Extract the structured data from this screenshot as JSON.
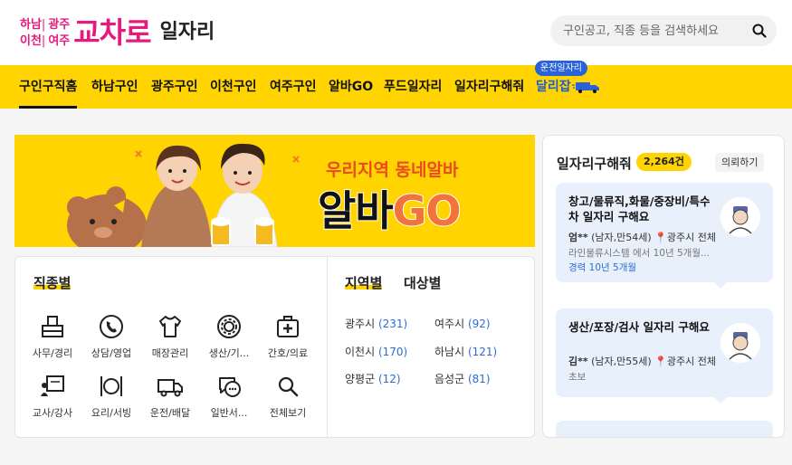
{
  "logo": {
    "regions": [
      "하남",
      "광주",
      "이천",
      "여주"
    ],
    "separator": "|",
    "main": "교차로",
    "sub": "일자리"
  },
  "search": {
    "placeholder": "구인공고, 직종 등을 검색하세요"
  },
  "nav": {
    "items": [
      "구인구직홈",
      "하남구인",
      "광주구인",
      "이천구인",
      "여주구인",
      "알바GO",
      "푸드일자리",
      "일자리구해줘",
      "달리잡"
    ],
    "active_index": 0,
    "badge": "운전일자리"
  },
  "banner": {
    "headline": "우리지역 동네알바",
    "brand_part1": "알바",
    "brand_part2": "GO"
  },
  "job_categories": {
    "title": "직종별",
    "items": [
      {
        "label": "사무/경리",
        "icon": "office-desk-icon"
      },
      {
        "label": "상담/영업",
        "icon": "phone-icon"
      },
      {
        "label": "매장관리",
        "icon": "shirt-icon"
      },
      {
        "label": "생산/기...",
        "icon": "gear-icon"
      },
      {
        "label": "간호/의료",
        "icon": "medical-kit-icon"
      },
      {
        "label": "교사/강사",
        "icon": "blackboard-icon"
      },
      {
        "label": "요리/서빙",
        "icon": "dish-icon"
      },
      {
        "label": "운전/배달",
        "icon": "truck-icon"
      },
      {
        "label": "일반서...",
        "icon": "chat-icon"
      },
      {
        "label": "전체보기",
        "icon": "search-icon"
      }
    ]
  },
  "regions": {
    "tab_region": "지역별",
    "tab_target": "대상별",
    "items": [
      {
        "name": "광주시",
        "count": "(231)"
      },
      {
        "name": "여주시",
        "count": "(92)"
      },
      {
        "name": "이천시",
        "count": "(170)"
      },
      {
        "name": "하남시",
        "count": "(121)"
      },
      {
        "name": "양평군",
        "count": "(12)"
      },
      {
        "name": "음성군",
        "count": "(81)"
      }
    ]
  },
  "side": {
    "title": "일자리구해줘",
    "count": "2,264건",
    "request_button": "의뢰하기",
    "requests": [
      {
        "title": "창고/물류직,화물/중장비/특수차 일자리 구해요",
        "name": "엄**",
        "info": "(남자,만54세)",
        "location": "광주시 전체",
        "company": "라인물류시스템 에서 10년 5개월...",
        "experience": "경력 10년 5개월"
      },
      {
        "title": "생산/포장/검사 일자리 구해요",
        "name": "김**",
        "info": "(남자,만55세)",
        "location": "광주시 전체",
        "company": "초보",
        "experience": ""
      }
    ]
  },
  "colors": {
    "brand_pink": "#e8197d",
    "nav_yellow": "#ffd400",
    "link_blue": "#2f6bd8",
    "badge_blue": "#2962d9"
  }
}
